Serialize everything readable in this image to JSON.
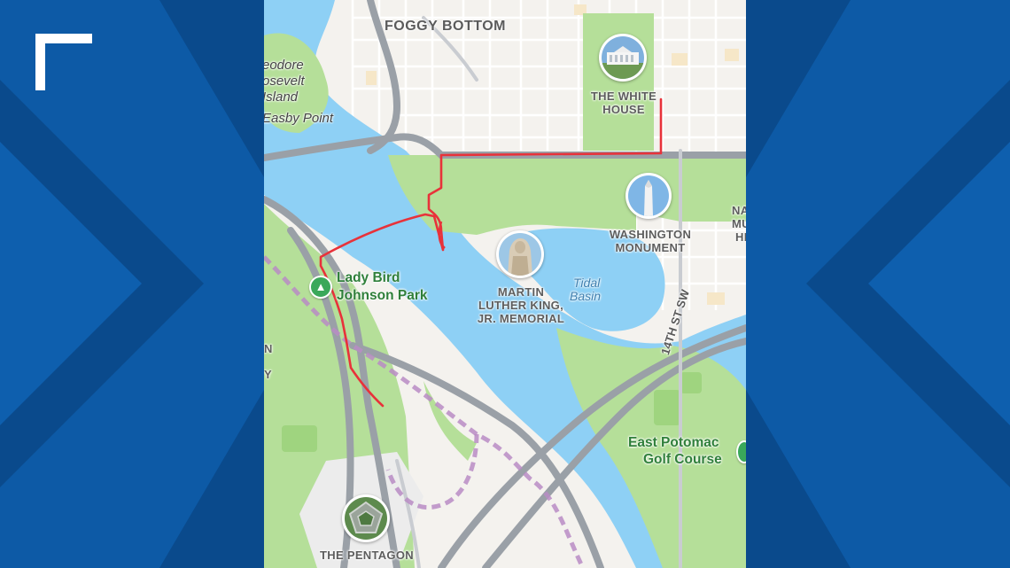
{
  "map": {
    "labels": {
      "foggy_bottom": "FOGGY BOTTOM",
      "roosevelt_island_1": "eodore",
      "roosevelt_island_2": "osevelt",
      "roosevelt_island_3": "Island",
      "gravelly_point": "Easby Point",
      "white_house_1": "THE WHITE",
      "white_house_2": "HOUSE",
      "washington_monument_1": "WASHINGTON",
      "washington_monument_2": "MONUMENT",
      "mlk_1": "MARTIN",
      "mlk_2": "LUTHER KING,",
      "mlk_3": "JR. MEMORIAL",
      "tidal_basin_1": "Tidal",
      "tidal_basin_2": "Basin",
      "lady_bird_1": "Lady Bird",
      "lady_bird_2": "Johnson Park",
      "street_14th": "14TH ST SW",
      "east_potomac_1": "East Potomac",
      "east_potomac_2": "Golf Course",
      "pentagon": "THE PENTAGON",
      "edge_na_1": "NA",
      "edge_na_2": "MU",
      "edge_na_3": "HI",
      "edge_left_1": "N",
      "edge_left_2": "Y"
    },
    "icons": {
      "white_house": "white-house-icon",
      "washington_monument": "obelisk-icon",
      "mlk_memorial": "statue-icon",
      "pentagon": "pentagon-icon",
      "park": "tree-icon"
    },
    "colors": {
      "route": "#e8323a",
      "water": "#8ed0f5",
      "park": "#b5df99",
      "road": "#9aa0a7",
      "boundary": "#b98cc4",
      "frame": "#0b4f95"
    }
  }
}
